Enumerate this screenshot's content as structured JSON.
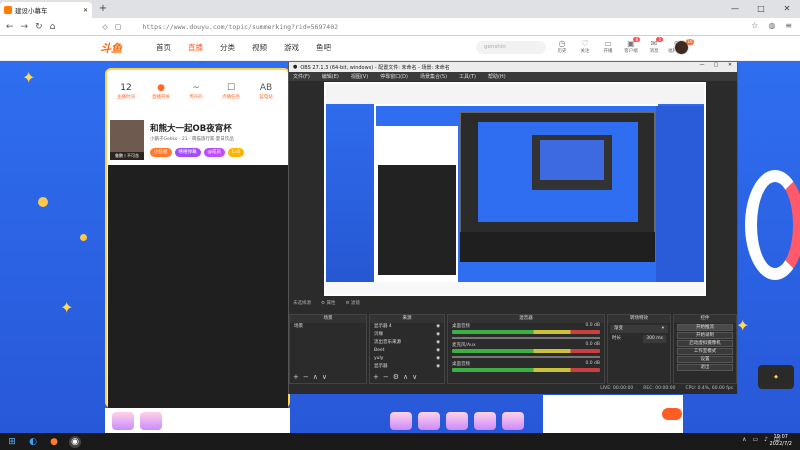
{
  "browser": {
    "tab_title": "建设小幕车",
    "new_tab": "+",
    "url": "https://www.douyu.com/topic/summerking?rid=5697402",
    "win_min": "—",
    "win_max": "□",
    "win_close": "✕"
  },
  "site": {
    "logo": "斗鱼",
    "nav": [
      "首页",
      "直播",
      "分类",
      "视频",
      "游戏",
      "鱼吧"
    ],
    "search_placeholder": "genshin",
    "top_icons": [
      {
        "label": "历史",
        "glyph": "◷",
        "badge": ""
      },
      {
        "label": "关注",
        "glyph": "♡",
        "badge": ""
      },
      {
        "label": "开播",
        "glyph": "▭",
        "badge": ""
      },
      {
        "label": "客户端",
        "glyph": "▣",
        "badge": "8"
      },
      {
        "label": "消息",
        "glyph": "✉",
        "badge": "2"
      },
      {
        "label": "福利中心",
        "glyph": "⊕",
        "badge": ""
      }
    ],
    "avatar_badge": "16"
  },
  "panel": {
    "items": [
      {
        "value": "12",
        "label": "主播时间"
      },
      {
        "value": "●",
        "label": "直播开关"
      },
      {
        "value": "~",
        "label": "传声码"
      },
      {
        "value": "☐",
        "label": "点播任务"
      },
      {
        "value": "AB",
        "label": "蓝电站"
      }
    ],
    "streamer_title": "和熊大一起OB夜宵杯",
    "streamer_sub": "小鹅子Gekko · 21 · 萌猫旅行家·夏日饮品",
    "tags": [
      "小技能",
      "嘻嘻弹幕",
      "@成员",
      "Lv6"
    ],
    "avatar_caption": "鲁鹏丨不可含"
  },
  "obs": {
    "title": "OBS 27.1.3 (64-bit, windows) - 配置文件: 未命名 - 场景: 未命名",
    "menu": [
      "文件(F)",
      "编辑(E)",
      "视图(V)",
      "停靠窗口(D)",
      "场景集合(S)",
      "工具(T)",
      "帮助(H)"
    ],
    "status_under_preview": [
      "未选择源",
      "⚙ 属性",
      "⚙ 滤镜"
    ],
    "docks": {
      "scenes": {
        "header": "场景",
        "items": [
          "场景"
        ]
      },
      "sources": {
        "header": "来源",
        "items": [
          "显示器 4",
          "贝缘",
          "流出音乐来源",
          "Beet",
          "yuly",
          "显示器"
        ]
      },
      "mixer": {
        "header": "混音器",
        "channels": [
          {
            "name": "桌面音频",
            "db": "0.0 dB"
          },
          {
            "name": "麦克风/Aux",
            "db": "0.0 dB"
          },
          {
            "name": "桌面音频",
            "db": "0.0 dB"
          }
        ]
      },
      "transitions": {
        "header": "转场特效",
        "type": "渐变",
        "duration_label": "时长",
        "duration": "300 ms"
      },
      "controls": {
        "header": "控件",
        "buttons": [
          "开始推流",
          "开始录制",
          "启动虚拟摄像机",
          "工作室模式",
          "设置",
          "退出"
        ]
      }
    },
    "statusbar": {
      "live": "LIVE: 00:00:00",
      "rec": "REC: 00:00:00",
      "cpu": "CPU: 0.4%, 60.00 fps"
    },
    "scene_btns": [
      "+",
      "−",
      "∧",
      "∨"
    ],
    "source_btns": [
      "+",
      "−",
      "⚙",
      "∧",
      "∨"
    ]
  },
  "taskbar": {
    "clock_time": "19:07",
    "clock_date": "2022/7/2",
    "tray": [
      "∧",
      "▭",
      "♪",
      "中"
    ]
  },
  "colors": {
    "accent": "#ff5d23",
    "page_blue": "#2f6ef0",
    "obs_dark": "#2b2b2b"
  }
}
